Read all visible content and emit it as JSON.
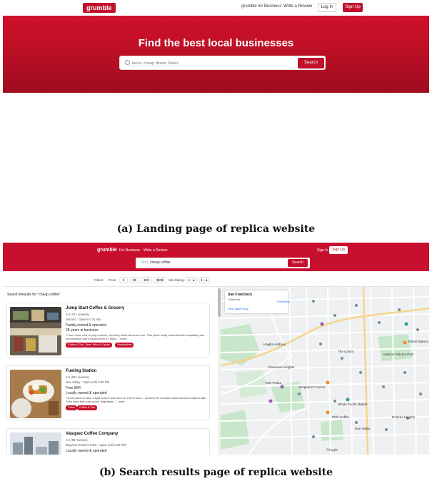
{
  "landing": {
    "logo": "grumble",
    "nav": {
      "business": "grumble for Business",
      "review": "Write a Review",
      "login": "Log In",
      "signup": "Sign Up"
    },
    "hero_title": "Find the best local businesses",
    "search": {
      "placeholder": "tacos, cheap dinner, Max's",
      "button": "Search"
    },
    "caption": "(a) Landing page of replica website"
  },
  "results_page": {
    "logo": "grumble",
    "nav": {
      "business": "For Business",
      "review": "Write a Review",
      "signin": "Sign In",
      "signup": "Sign Up"
    },
    "search": {
      "label": "Find",
      "value": "cheap coffee",
      "button": "Search"
    },
    "filters": {
      "label": "Filters:",
      "price_label": "Price:",
      "prices": [
        "$",
        "$$",
        "$$$",
        "$$$$"
      ],
      "min_rating_label": "Min Rating:",
      "ratings": [
        "4+ ★",
        "3+ ★"
      ]
    },
    "results_title": "Search Results for \"cheap coffee\"",
    "cards": [
      {
        "name": "Jump Start Coffee & Grocery",
        "rating": "4.5 (121 reviews)",
        "meta": "Mission · Opens in 21 min",
        "highlight1": "Family-owned & operated",
        "highlight2": "28 years in business",
        "quote": "\"I don't write a lot of yelp reviews, but Jump Start deserves one. This place really embodies the hospitality and convenience you'd expect from a 1950s...\" more",
        "tags": [
          "Coffee & Tea",
          "Beer, Wine & Spirits",
          "Sandwiches"
        ]
      },
      {
        "name": "Fueling Station",
        "rating": "4.5 (261 reviews)",
        "meta": "Noe Valley · Open until 5:00 PM",
        "highlight1": "Free WiFi",
        "highlight2": "Locally owned & operated",
        "quote": "\"Great place to have a light brunch and work for a few hours. I ordered the avocado toast and iced matcha latte. They were both very good! Vegetarian...\" more",
        "tags": [
          "Cafes",
          "Coffee & Tea"
        ]
      },
      {
        "name": "Vasquez Coffee Company",
        "rating": "4.4 (89 reviews)",
        "meta": "Bayview-Hunters Point · Open until 2:30 PM",
        "highlight1": "Locally owned & operated",
        "highlight2": "",
        "quote": "",
        "tags": []
      }
    ],
    "map": {
      "city": "San Francisco",
      "state": "California",
      "directions": "Directions",
      "larger_map": "View larger map",
      "labels": [
        "Haight-Ashbury",
        "Mission Dolores Park",
        "Twin Peaks",
        "The Castro",
        "Noe Valley",
        "Clarendon Heights",
        "Whole Foods Market",
        "Philz Coffee",
        "Neighbor's Corner",
        "Tartine Bakery",
        "Dolores Heights",
        "Google"
      ]
    },
    "caption": "(b) Search results page of replica website"
  },
  "colors": {
    "brand_red": "#c8102e",
    "map_bg": "#eef0f2",
    "map_green": "#c8e6c9"
  }
}
